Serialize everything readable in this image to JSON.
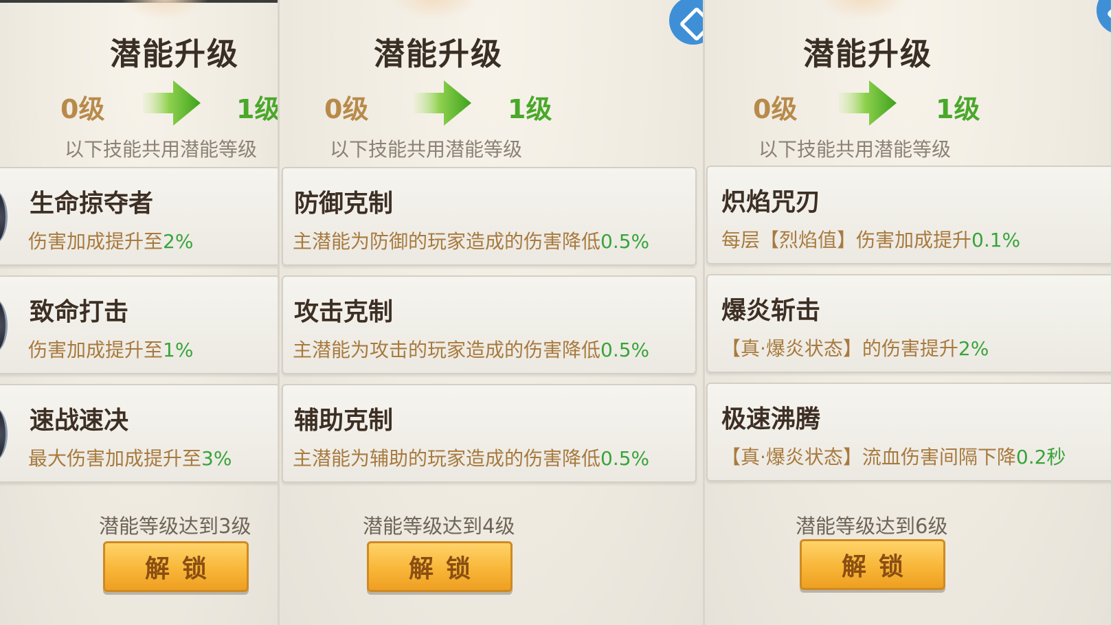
{
  "panels": [
    {
      "title": "潜能升级",
      "from_level": "0级",
      "to_level": "1级",
      "subtitle": "以下技能共用潜能等级",
      "skills": [
        {
          "name": "生命掠夺者",
          "desc": "伤害加成提升至",
          "value": "2%"
        },
        {
          "name": "致命打击",
          "desc": "伤害加成提升至",
          "value": "1%"
        },
        {
          "name": "速战速决",
          "desc": "最大伤害加成提升至",
          "value": "3%"
        }
      ],
      "requirement": "潜能等级达到3级",
      "unlock_label": "解锁"
    },
    {
      "title": "潜能升级",
      "from_level": "0级",
      "to_level": "1级",
      "subtitle": "以下技能共用潜能等级",
      "skills": [
        {
          "name": "防御克制",
          "desc": "主潜能为防御的玩家造成的伤害降低",
          "value": "0.5%"
        },
        {
          "name": "攻击克制",
          "desc": "主潜能为攻击的玩家造成的伤害降低",
          "value": "0.5%"
        },
        {
          "name": "辅助克制",
          "desc": "主潜能为辅助的玩家造成的伤害降低",
          "value": "0.5%"
        }
      ],
      "requirement": "潜能等级达到4级",
      "unlock_label": "解锁"
    },
    {
      "title": "潜能升级",
      "from_level": "0级",
      "to_level": "1级",
      "subtitle": "以下技能共用潜能等级",
      "skills": [
        {
          "name": "炽焰咒刃",
          "desc": "每层【烈焰值】伤害加成提升",
          "value": "0.1%"
        },
        {
          "name": "爆炎斩击",
          "desc": "【真·爆炎状态】的伤害提升",
          "value": "2%"
        },
        {
          "name": "极速沸腾",
          "desc": "【真·爆炎状态】流血伤害间隔下降",
          "value": "0.2秒"
        }
      ],
      "requirement": "潜能等级达到6级",
      "unlock_label": "解锁"
    }
  ],
  "colors": {
    "highlight": "#38a43a",
    "desc": "#a87a3e",
    "from_level": "#b88a4a",
    "to_level": "#4aa82a",
    "button": "#f8b638"
  },
  "icons": [
    "arrow-right-icon",
    "skill-icon",
    "close-icon"
  ]
}
